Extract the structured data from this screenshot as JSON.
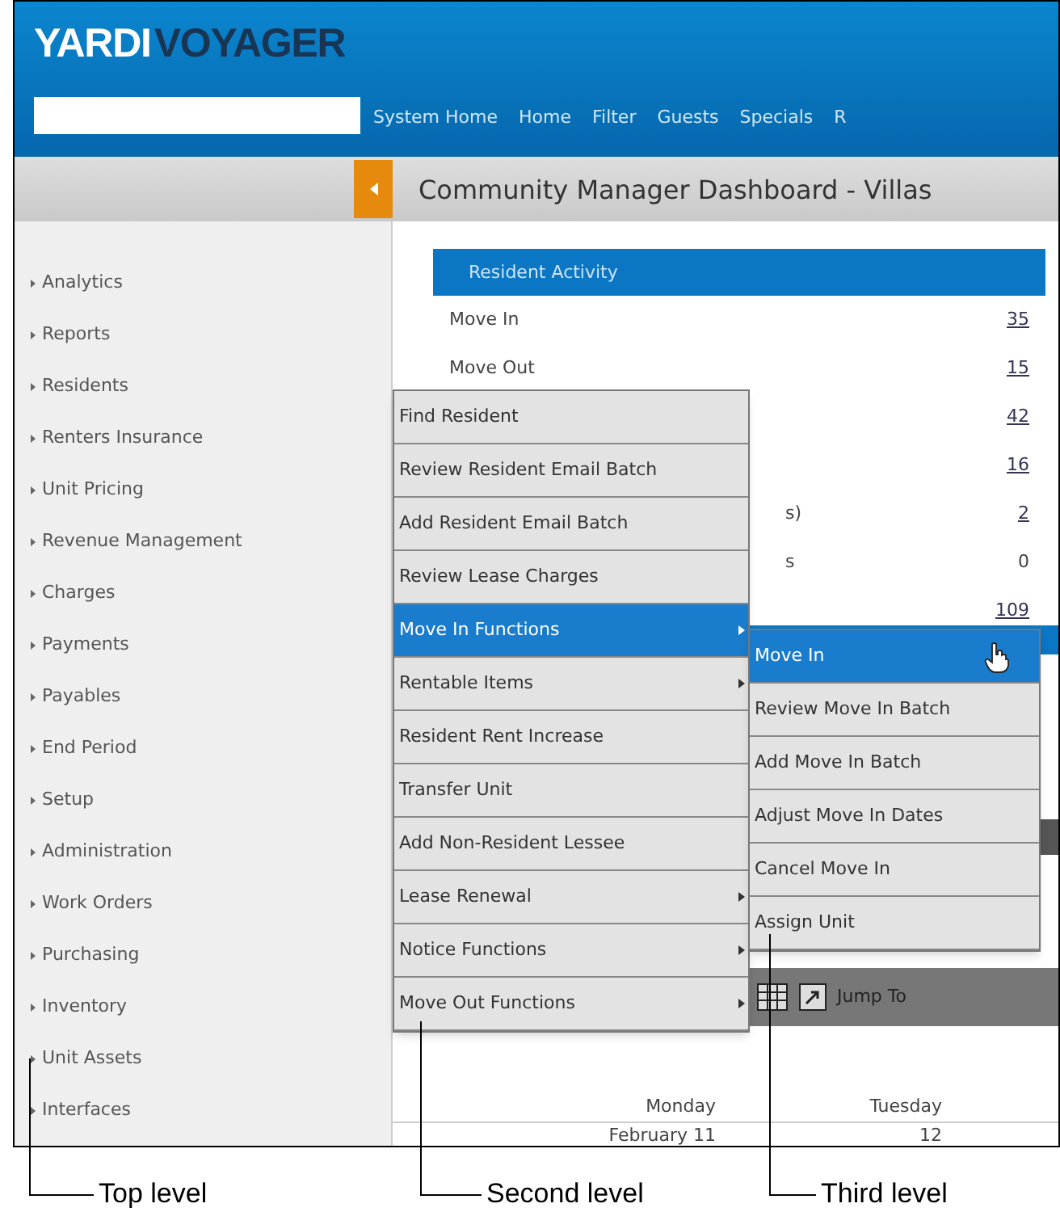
{
  "logo": {
    "part_1": "YARDI",
    "part_2": "VOYAGER"
  },
  "nav": [
    "System Home",
    "Home",
    "Filter",
    "Guests",
    "Specials",
    "R"
  ],
  "title": "Community Manager Dashboard - Villas",
  "sidebar": {
    "items": [
      "Analytics",
      "Reports",
      "Residents",
      "Renters Insurance",
      "Unit Pricing",
      "Revenue Management",
      "Charges",
      "Payments",
      "Payables",
      "End Period",
      "Setup",
      "Administration",
      "Work Orders",
      "Purchasing",
      "Inventory",
      "Unit Assets",
      "Interfaces"
    ]
  },
  "resident_activity": {
    "title": "Resident Activity",
    "rows": [
      {
        "label": "Move In",
        "value": "35",
        "link": true
      },
      {
        "label": "Move Out",
        "value": "15",
        "link": true
      },
      {
        "value": "42",
        "link": true
      },
      {
        "value": "16",
        "link": true
      },
      {
        "label": "s)",
        "value": "2",
        "link": true
      },
      {
        "label": "s",
        "value": "0",
        "link": false
      },
      {
        "value": "109",
        "link": true
      }
    ]
  },
  "toolbar": {
    "label": "Jump To"
  },
  "calendar": {
    "days": [
      {
        "day": "Monday",
        "date": "February 11"
      },
      {
        "day": "Tuesday",
        "date": "12"
      }
    ]
  },
  "second_level_menu": [
    {
      "label": "Find Resident",
      "selected": false,
      "has_submenu": false
    },
    {
      "label": "Review Resident Email Batch",
      "selected": false,
      "has_submenu": false
    },
    {
      "label": "Add Resident Email Batch",
      "selected": false,
      "has_submenu": false
    },
    {
      "label": "Review Lease Charges",
      "selected": false,
      "has_submenu": false
    },
    {
      "label": "Move In Functions",
      "selected": true,
      "has_submenu": true
    },
    {
      "label": "Rentable Items",
      "selected": false,
      "has_submenu": true
    },
    {
      "label": "Resident Rent Increase",
      "selected": false,
      "has_submenu": false
    },
    {
      "label": "Transfer Unit",
      "selected": false,
      "has_submenu": false
    },
    {
      "label": "Add Non-Resident Lessee",
      "selected": false,
      "has_submenu": false
    },
    {
      "label": "Lease Renewal",
      "selected": false,
      "has_submenu": true
    },
    {
      "label": "Notice Functions",
      "selected": false,
      "has_submenu": true
    },
    {
      "label": "Move Out Functions",
      "selected": false,
      "has_submenu": true
    }
  ],
  "third_level_menu": [
    {
      "label": "Move In",
      "selected": true
    },
    {
      "label": "Review Move In Batch",
      "selected": false
    },
    {
      "label": "Add Move In Batch",
      "selected": false
    },
    {
      "label": "Adjust Move In Dates",
      "selected": false
    },
    {
      "label": "Cancel Move In",
      "selected": false
    },
    {
      "label": "Assign Unit",
      "selected": false
    }
  ],
  "annotations": [
    "Top level",
    "Second level",
    "Third level"
  ]
}
